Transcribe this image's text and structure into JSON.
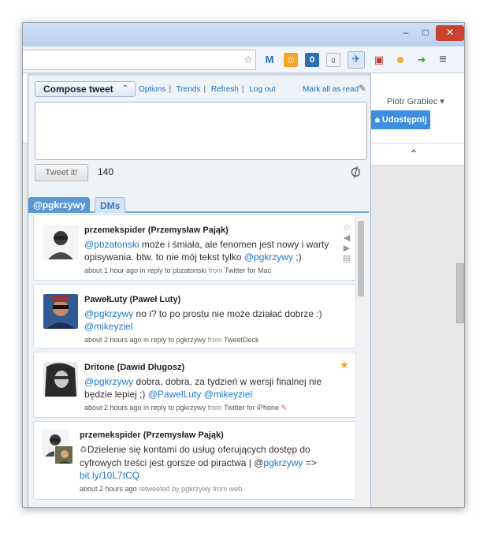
{
  "window": {
    "controls": {
      "minimize": "–",
      "maximize": "□",
      "close": "✕"
    }
  },
  "toolbar": {
    "icons": [
      "star-icon",
      "gmail-icon",
      "orange-extension-icon",
      "badge-blue-icon",
      "badge-gray-icon",
      "tweet-extension-icon",
      "red-extension-icon",
      "smiley-extension-icon",
      "green-extension-icon",
      "menu-icon"
    ],
    "badge_blue": "0",
    "badge_gray": "0"
  },
  "page": {
    "user_name": "Piotr Grabiec ▾",
    "share_button": "Udostępnij",
    "collapse_chevron": "«"
  },
  "popup": {
    "compose_tab": "Compose tweet",
    "compose_chevron": "«",
    "links": {
      "options": "Options",
      "trends": "Trends",
      "refresh": "Refresh",
      "logout": "Log out",
      "sep": "|"
    },
    "mark_all_read": "Mark all as read",
    "compose_text": "",
    "tweet_button": "Tweet it!",
    "char_count": "140",
    "tabs": {
      "timeline": "@pgkrzywy",
      "dms": "DMs"
    },
    "tweets": [
      {
        "name": "przemekspider (Przemysław Pająk)",
        "text_link1": "@pbzatonski",
        "text_rest": " może i śmiała, ale fenomen jest nowy i warty opisywania. btw. to nie mój tekst tylko ",
        "text_link2": "@pgkrzywy",
        "text_end": " ;)",
        "meta": "about 1 hour ago in reply to pbzatonski",
        "meta_from": "from",
        "source": "Twitter for Mac"
      },
      {
        "name": "PawełLuty (Paweł Luty)",
        "text_link1": "@pgkrzywy",
        "text_rest": " no i? to po prostu nie może działać dobrze :) ",
        "text_link2": "@mikeyziel",
        "text_end": "",
        "meta": "about 2 hours ago in reply to pgkrzywy",
        "meta_from": "from",
        "source": "TweetDeck"
      },
      {
        "name": "Dritone (Dawid Długosz)",
        "text_link1": "@pgkrzywy",
        "text_rest": " dobra, dobra, za tydzień w wersji finalnej nie będzie lepiej ;) ",
        "text_link2": "@PawelLuty",
        "text_mid": " ",
        "text_link3": "@mikeyziel",
        "meta": "about 2 hours ago in reply to pgkrzywy",
        "meta_from": "from",
        "source": "Twitter for iPhone"
      },
      {
        "name": "przemekspider (Przemysław Pająk)",
        "text_pre": "Dzielenie się kontami do usług oferujących dostęp do cyfrowych treści jest gorsze od piractwa | @",
        "text_link1": "pgkrzywy",
        "text_rest": " => ",
        "text_link2": "bit.ly/10L7tCQ",
        "meta": "about 2 hours ago",
        "meta_rt": "retweeted by pgkrzywy",
        "meta_from": "from web"
      }
    ]
  },
  "colors": {
    "link": "#1f78c9",
    "tab_active": "#5b97d6",
    "share_button": "#3d8de0",
    "close_button": "#c8442f",
    "favorite_star": "#f0a025"
  }
}
